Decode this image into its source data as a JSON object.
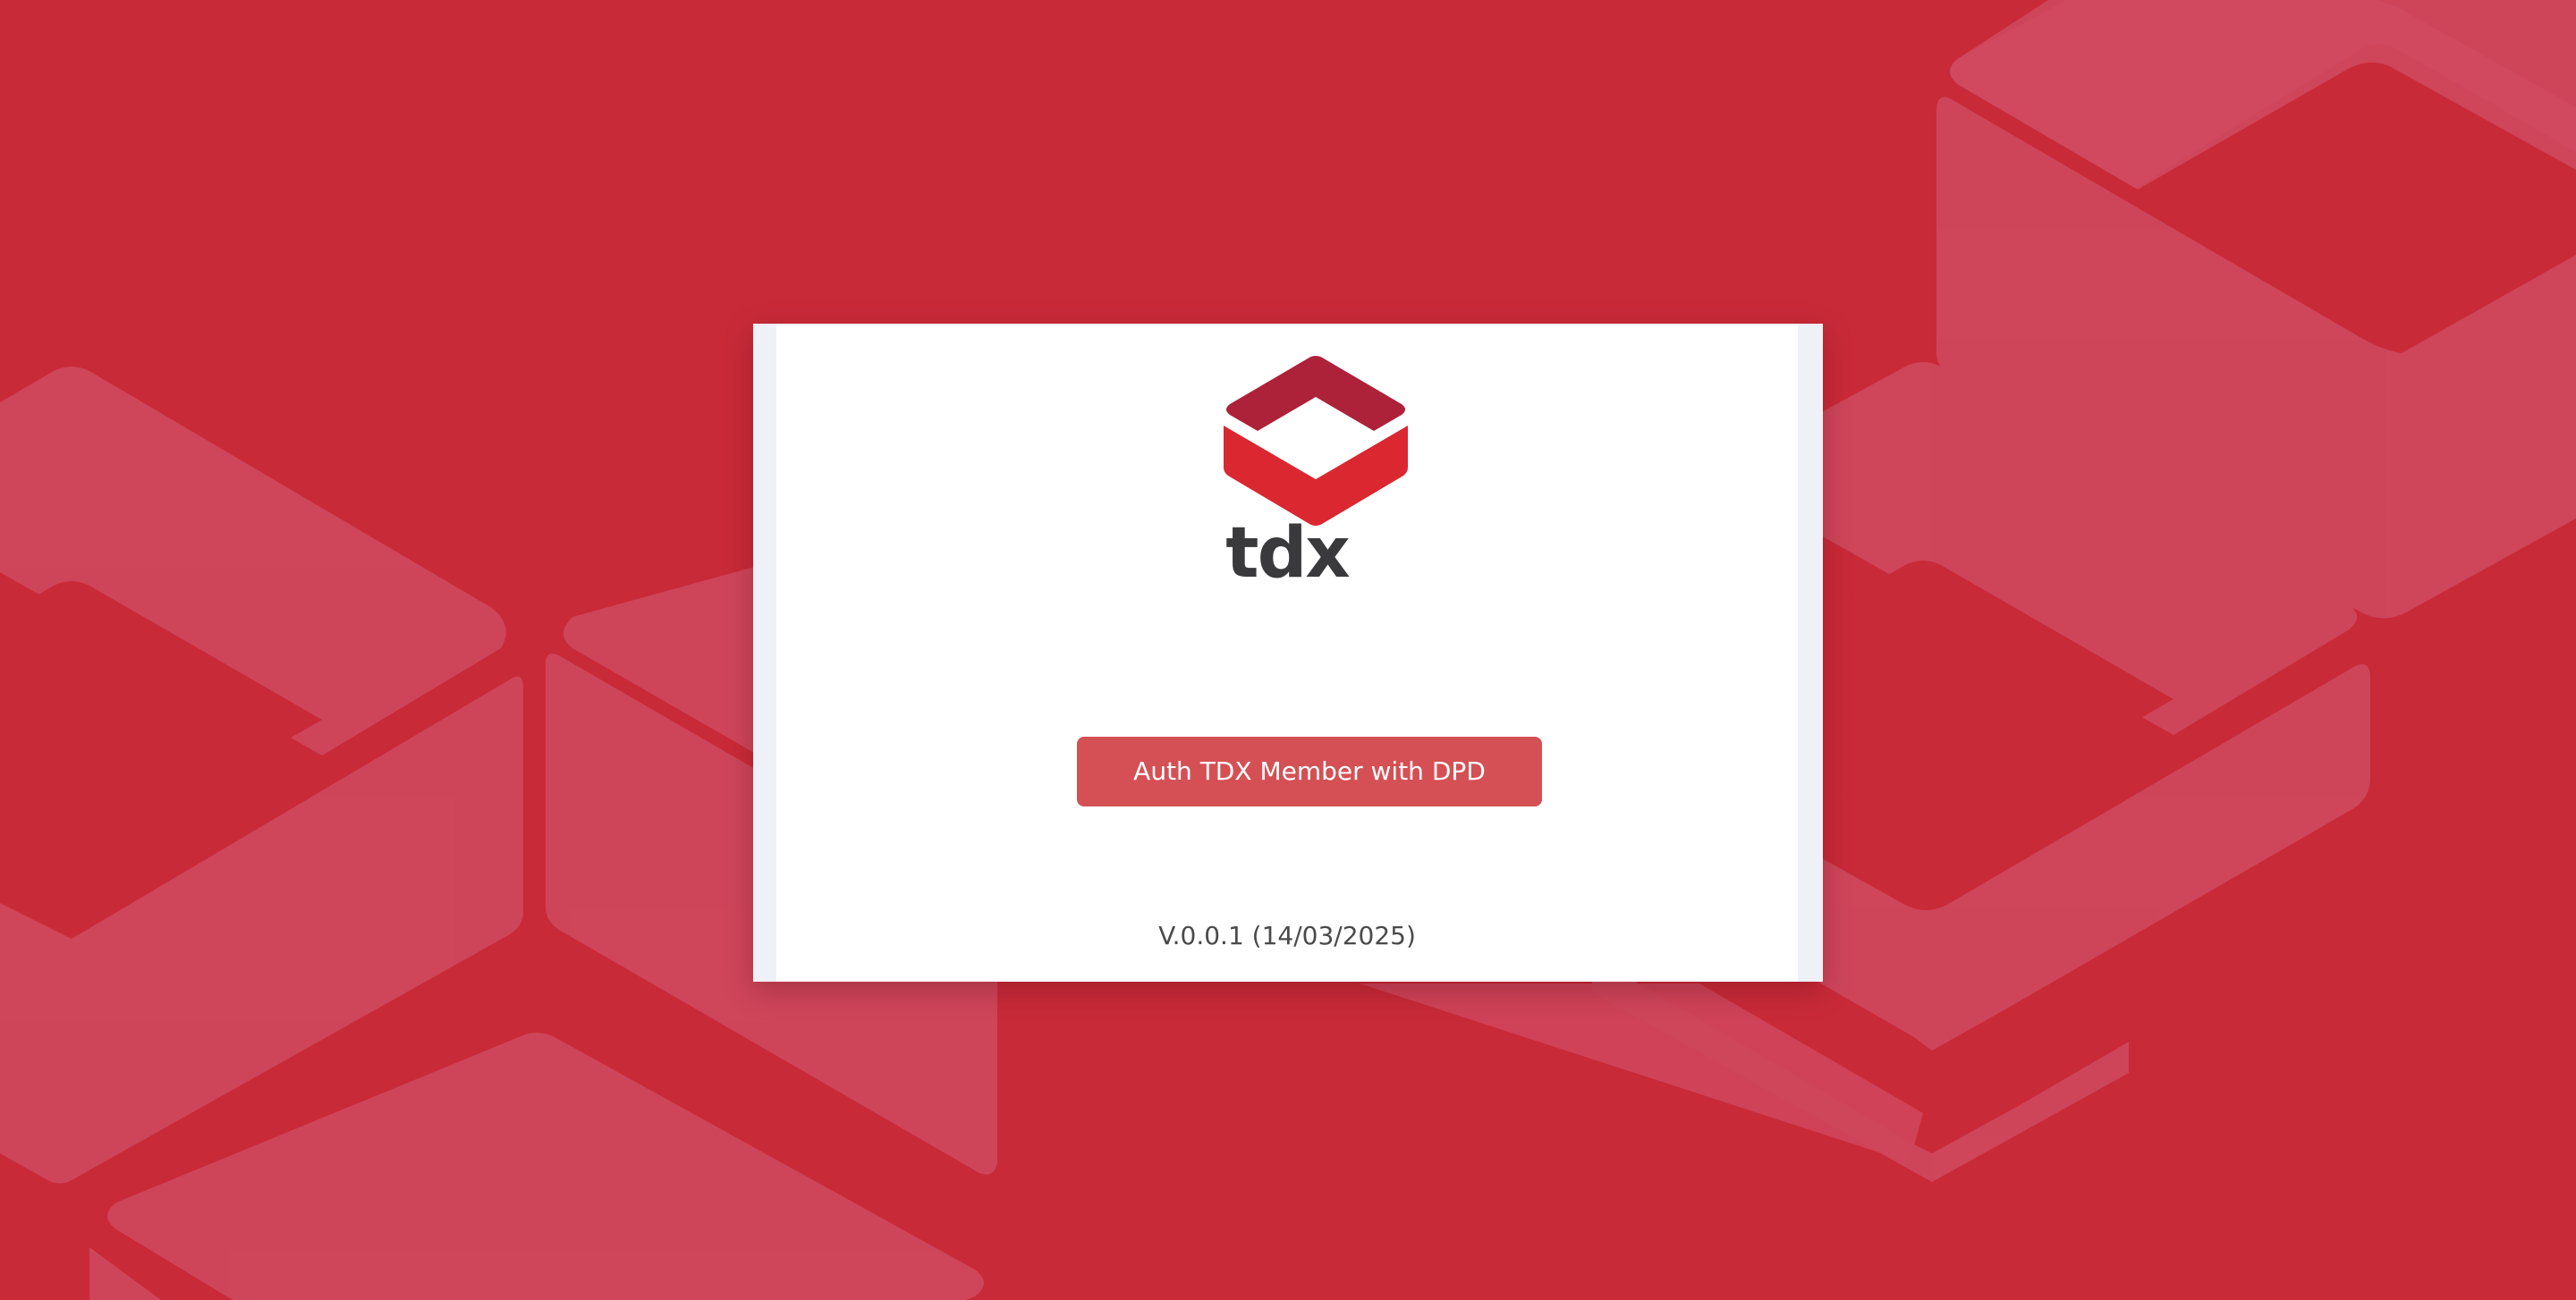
{
  "colors": {
    "background": "#c92a38",
    "pattern_shape": "#d04a60",
    "card_border": "#eef1f6",
    "card": "#ffffff",
    "button": "#d45054",
    "logo_dark": "#ad2139",
    "logo_light": "#da2730",
    "brand_text": "#3a3a3c"
  },
  "logo": {
    "icon": "tdx-cube-logo-icon",
    "text": "tdx"
  },
  "auth_button": {
    "label": "Auth TDX Member with DPD"
  },
  "version": {
    "text": "V.0.0.1 (14/03/2025)"
  }
}
